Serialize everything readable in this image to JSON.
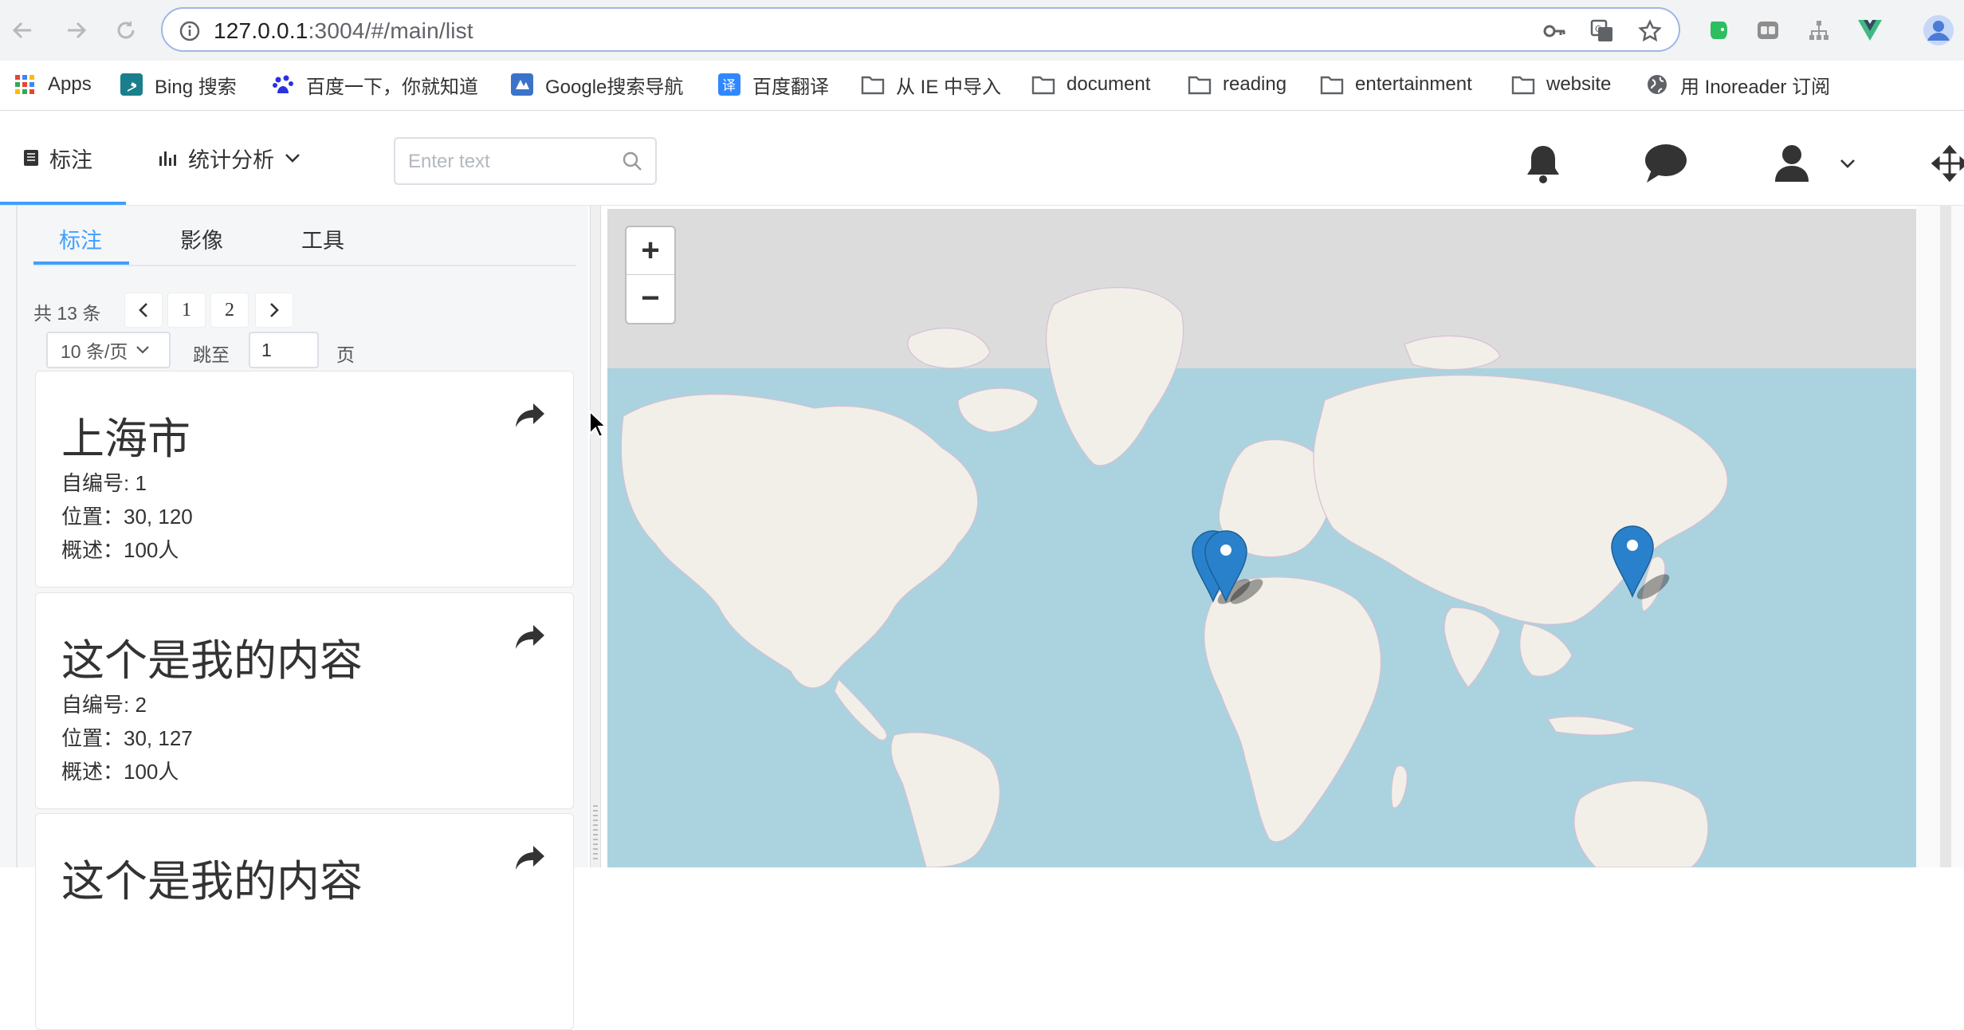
{
  "browser": {
    "url_host": "127.0.0.1",
    "url_rest": ":3004/#/main/list",
    "bookmarks": [
      {
        "label": "Apps",
        "icon": "apps-grid-icon"
      },
      {
        "label": "Bing 搜索",
        "icon": "bing-icon"
      },
      {
        "label": "百度一下，你就知道",
        "icon": "baidu-icon"
      },
      {
        "label": "Google搜索导航",
        "icon": "google-nav-icon"
      },
      {
        "label": "百度翻译",
        "icon": "translate-icon"
      },
      {
        "label": "从 IE 中导入",
        "icon": "folder-icon"
      },
      {
        "label": "document",
        "icon": "folder-icon"
      },
      {
        "label": "reading",
        "icon": "folder-icon"
      },
      {
        "label": "entertainment",
        "icon": "folder-icon"
      },
      {
        "label": "website",
        "icon": "folder-icon"
      },
      {
        "label": "用 Inoreader 订阅",
        "icon": "globe-icon"
      }
    ]
  },
  "header": {
    "menu_mark": "标注",
    "menu_stats": "统计分析",
    "search_placeholder": "Enter text"
  },
  "tabs": [
    {
      "label": "标注",
      "active": true
    },
    {
      "label": "影像",
      "active": false
    },
    {
      "label": "工具",
      "active": false
    }
  ],
  "pagination": {
    "total_text": "共 13 条",
    "pages": [
      "1",
      "2"
    ],
    "page_size": "10 条/页",
    "jump_prefix": "跳至",
    "jump_value": "1",
    "jump_suffix": "页"
  },
  "cards": [
    {
      "title": "上海市",
      "id_line": "自编号: 1",
      "pos_line": "位置：30, 120",
      "desc_line": "概述：100人"
    },
    {
      "title": "这个是我的内容",
      "id_line": "自编号: 2",
      "pos_line": "位置：30, 127",
      "desc_line": "概述：100人"
    },
    {
      "title": "这个是我的内容",
      "id_line": "",
      "pos_line": "",
      "desc_line": ""
    }
  ],
  "map": {
    "zoom_in": "+",
    "zoom_out": "−",
    "ocean_color": "#aad3df",
    "land_color": "#f2efe9",
    "marker_color": "#2a81cb"
  }
}
